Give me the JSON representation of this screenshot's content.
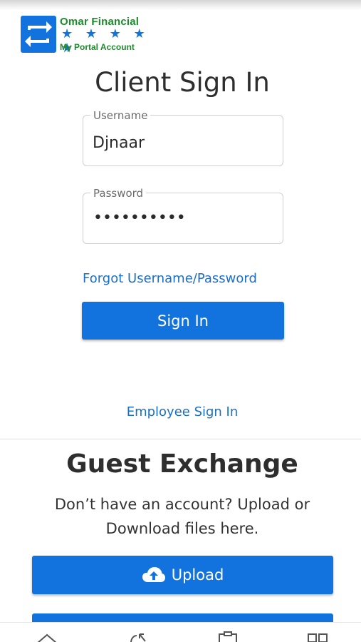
{
  "logo": {
    "name": "Omar Financial",
    "stars": "★ ★ ★ ★ ★",
    "subtitle": "My Portal Account"
  },
  "signin": {
    "title": "Client Sign In",
    "username_label": "Username",
    "username_value": "Djnaar",
    "password_label": "Password",
    "password_value": "••••••••••",
    "forgot_link": "Forgot Username/Password",
    "button_label": "Sign In",
    "employee_link": "Employee Sign In"
  },
  "guest": {
    "title": "Guest Exchange",
    "description": "Don’t have an account? Upload or Download files here.",
    "upload_label": "Upload"
  },
  "colors": {
    "primary": "#1273de",
    "link": "#1a6fc7",
    "logo_green": "#1d8a2c"
  },
  "bottom_nav": [
    "home-icon",
    "refresh-icon",
    "clipboard-icon",
    "grid-icon"
  ]
}
